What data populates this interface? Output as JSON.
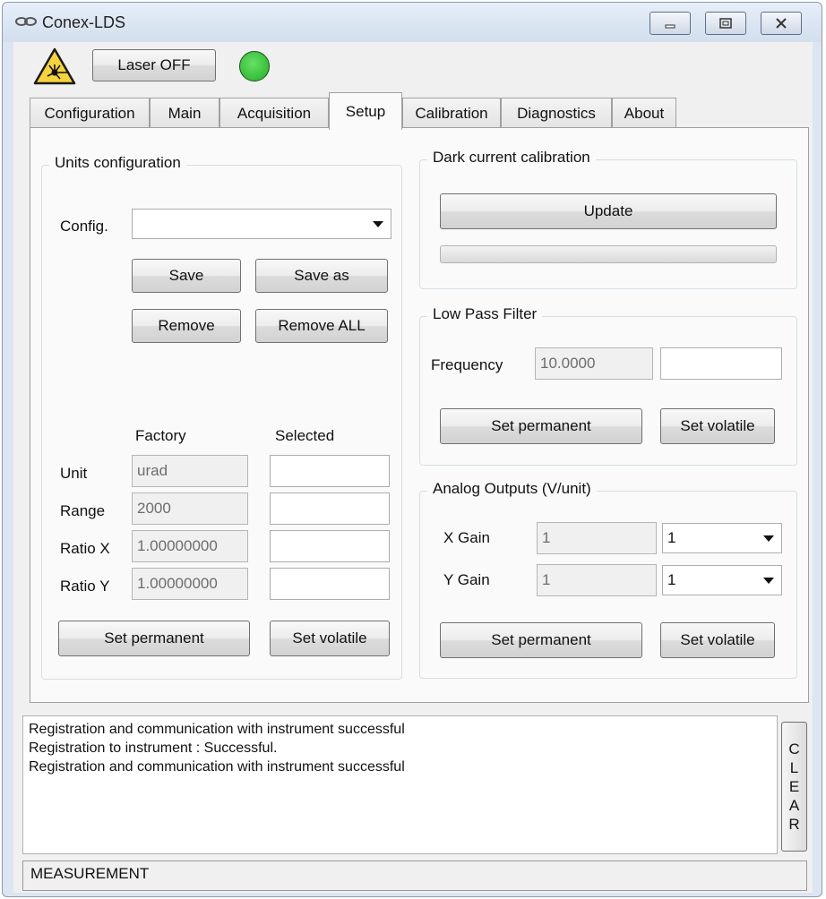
{
  "window": {
    "title": "Conex-LDS",
    "icon": "link-icon"
  },
  "toolbar": {
    "laser_label": "Laser OFF",
    "warning_icon": "laser-warning-icon",
    "status_led_color": "#22b022"
  },
  "tabs": [
    {
      "label": "Configuration"
    },
    {
      "label": "Main"
    },
    {
      "label": "Acquisition"
    },
    {
      "label": "Setup",
      "active": true
    },
    {
      "label": "Calibration"
    },
    {
      "label": "Diagnostics"
    },
    {
      "label": "About"
    }
  ],
  "units": {
    "legend": "Units configuration",
    "config_label": "Config.",
    "config_value": "",
    "save": "Save",
    "save_as": "Save as",
    "remove": "Remove",
    "remove_all": "Remove ALL",
    "col_factory": "Factory",
    "col_selected": "Selected",
    "rows": [
      {
        "label": "Unit",
        "factory": "urad",
        "selected": ""
      },
      {
        "label": "Range",
        "factory": "2000",
        "selected": ""
      },
      {
        "label": "Ratio X",
        "factory": "1.00000000",
        "selected": ""
      },
      {
        "label": "Ratio Y",
        "factory": "1.00000000",
        "selected": ""
      }
    ],
    "set_permanent": "Set permanent",
    "set_volatile": "Set volatile"
  },
  "dark": {
    "legend": "Dark current calibration",
    "update": "Update",
    "progress": 0
  },
  "lpf": {
    "legend": "Low Pass Filter",
    "freq_label": "Frequency",
    "freq_value": "10.0000",
    "freq_new": "",
    "set_permanent": "Set permanent",
    "set_volatile": "Set volatile"
  },
  "analog": {
    "legend": "Analog Outputs (V/unit)",
    "x_label": "X Gain",
    "x_value": "1",
    "x_select": "1",
    "y_label": "Y Gain",
    "y_value": "1",
    "y_select": "1",
    "set_permanent": "Set permanent",
    "set_volatile": "Set volatile"
  },
  "log": {
    "lines": [
      "Registration and communication with instrument successful",
      "Registration to instrument : Successful.",
      "Registration and communication with instrument successful"
    ],
    "clear_letters": [
      "C",
      "L",
      "E",
      "A",
      "R"
    ]
  },
  "status": {
    "text": "MEASUREMENT"
  }
}
